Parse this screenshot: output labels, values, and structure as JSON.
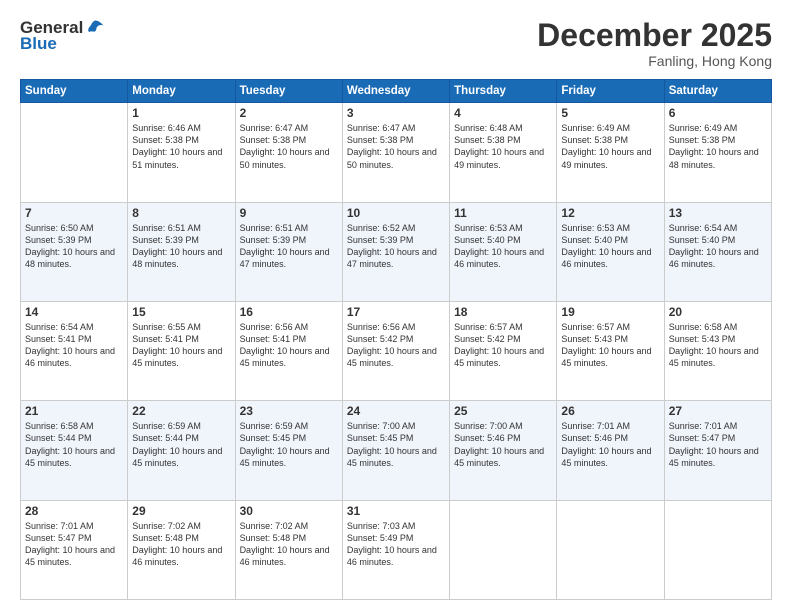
{
  "logo": {
    "general": "General",
    "blue": "Blue"
  },
  "title": "December 2025",
  "subtitle": "Fanling, Hong Kong",
  "header_days": [
    "Sunday",
    "Monday",
    "Tuesday",
    "Wednesday",
    "Thursday",
    "Friday",
    "Saturday"
  ],
  "weeks": [
    [
      {
        "day": "",
        "sunrise": "",
        "sunset": "",
        "daylight": ""
      },
      {
        "day": "1",
        "sunrise": "Sunrise: 6:46 AM",
        "sunset": "Sunset: 5:38 PM",
        "daylight": "Daylight: 10 hours and 51 minutes."
      },
      {
        "day": "2",
        "sunrise": "Sunrise: 6:47 AM",
        "sunset": "Sunset: 5:38 PM",
        "daylight": "Daylight: 10 hours and 50 minutes."
      },
      {
        "day": "3",
        "sunrise": "Sunrise: 6:47 AM",
        "sunset": "Sunset: 5:38 PM",
        "daylight": "Daylight: 10 hours and 50 minutes."
      },
      {
        "day": "4",
        "sunrise": "Sunrise: 6:48 AM",
        "sunset": "Sunset: 5:38 PM",
        "daylight": "Daylight: 10 hours and 49 minutes."
      },
      {
        "day": "5",
        "sunrise": "Sunrise: 6:49 AM",
        "sunset": "Sunset: 5:38 PM",
        "daylight": "Daylight: 10 hours and 49 minutes."
      },
      {
        "day": "6",
        "sunrise": "Sunrise: 6:49 AM",
        "sunset": "Sunset: 5:38 PM",
        "daylight": "Daylight: 10 hours and 48 minutes."
      }
    ],
    [
      {
        "day": "7",
        "sunrise": "Sunrise: 6:50 AM",
        "sunset": "Sunset: 5:39 PM",
        "daylight": "Daylight: 10 hours and 48 minutes."
      },
      {
        "day": "8",
        "sunrise": "Sunrise: 6:51 AM",
        "sunset": "Sunset: 5:39 PM",
        "daylight": "Daylight: 10 hours and 48 minutes."
      },
      {
        "day": "9",
        "sunrise": "Sunrise: 6:51 AM",
        "sunset": "Sunset: 5:39 PM",
        "daylight": "Daylight: 10 hours and 47 minutes."
      },
      {
        "day": "10",
        "sunrise": "Sunrise: 6:52 AM",
        "sunset": "Sunset: 5:39 PM",
        "daylight": "Daylight: 10 hours and 47 minutes."
      },
      {
        "day": "11",
        "sunrise": "Sunrise: 6:53 AM",
        "sunset": "Sunset: 5:40 PM",
        "daylight": "Daylight: 10 hours and 46 minutes."
      },
      {
        "day": "12",
        "sunrise": "Sunrise: 6:53 AM",
        "sunset": "Sunset: 5:40 PM",
        "daylight": "Daylight: 10 hours and 46 minutes."
      },
      {
        "day": "13",
        "sunrise": "Sunrise: 6:54 AM",
        "sunset": "Sunset: 5:40 PM",
        "daylight": "Daylight: 10 hours and 46 minutes."
      }
    ],
    [
      {
        "day": "14",
        "sunrise": "Sunrise: 6:54 AM",
        "sunset": "Sunset: 5:41 PM",
        "daylight": "Daylight: 10 hours and 46 minutes."
      },
      {
        "day": "15",
        "sunrise": "Sunrise: 6:55 AM",
        "sunset": "Sunset: 5:41 PM",
        "daylight": "Daylight: 10 hours and 45 minutes."
      },
      {
        "day": "16",
        "sunrise": "Sunrise: 6:56 AM",
        "sunset": "Sunset: 5:41 PM",
        "daylight": "Daylight: 10 hours and 45 minutes."
      },
      {
        "day": "17",
        "sunrise": "Sunrise: 6:56 AM",
        "sunset": "Sunset: 5:42 PM",
        "daylight": "Daylight: 10 hours and 45 minutes."
      },
      {
        "day": "18",
        "sunrise": "Sunrise: 6:57 AM",
        "sunset": "Sunset: 5:42 PM",
        "daylight": "Daylight: 10 hours and 45 minutes."
      },
      {
        "day": "19",
        "sunrise": "Sunrise: 6:57 AM",
        "sunset": "Sunset: 5:43 PM",
        "daylight": "Daylight: 10 hours and 45 minutes."
      },
      {
        "day": "20",
        "sunrise": "Sunrise: 6:58 AM",
        "sunset": "Sunset: 5:43 PM",
        "daylight": "Daylight: 10 hours and 45 minutes."
      }
    ],
    [
      {
        "day": "21",
        "sunrise": "Sunrise: 6:58 AM",
        "sunset": "Sunset: 5:44 PM",
        "daylight": "Daylight: 10 hours and 45 minutes."
      },
      {
        "day": "22",
        "sunrise": "Sunrise: 6:59 AM",
        "sunset": "Sunset: 5:44 PM",
        "daylight": "Daylight: 10 hours and 45 minutes."
      },
      {
        "day": "23",
        "sunrise": "Sunrise: 6:59 AM",
        "sunset": "Sunset: 5:45 PM",
        "daylight": "Daylight: 10 hours and 45 minutes."
      },
      {
        "day": "24",
        "sunrise": "Sunrise: 7:00 AM",
        "sunset": "Sunset: 5:45 PM",
        "daylight": "Daylight: 10 hours and 45 minutes."
      },
      {
        "day": "25",
        "sunrise": "Sunrise: 7:00 AM",
        "sunset": "Sunset: 5:46 PM",
        "daylight": "Daylight: 10 hours and 45 minutes."
      },
      {
        "day": "26",
        "sunrise": "Sunrise: 7:01 AM",
        "sunset": "Sunset: 5:46 PM",
        "daylight": "Daylight: 10 hours and 45 minutes."
      },
      {
        "day": "27",
        "sunrise": "Sunrise: 7:01 AM",
        "sunset": "Sunset: 5:47 PM",
        "daylight": "Daylight: 10 hours and 45 minutes."
      }
    ],
    [
      {
        "day": "28",
        "sunrise": "Sunrise: 7:01 AM",
        "sunset": "Sunset: 5:47 PM",
        "daylight": "Daylight: 10 hours and 45 minutes."
      },
      {
        "day": "29",
        "sunrise": "Sunrise: 7:02 AM",
        "sunset": "Sunset: 5:48 PM",
        "daylight": "Daylight: 10 hours and 46 minutes."
      },
      {
        "day": "30",
        "sunrise": "Sunrise: 7:02 AM",
        "sunset": "Sunset: 5:48 PM",
        "daylight": "Daylight: 10 hours and 46 minutes."
      },
      {
        "day": "31",
        "sunrise": "Sunrise: 7:03 AM",
        "sunset": "Sunset: 5:49 PM",
        "daylight": "Daylight: 10 hours and 46 minutes."
      },
      {
        "day": "",
        "sunrise": "",
        "sunset": "",
        "daylight": ""
      },
      {
        "day": "",
        "sunrise": "",
        "sunset": "",
        "daylight": ""
      },
      {
        "day": "",
        "sunrise": "",
        "sunset": "",
        "daylight": ""
      }
    ]
  ]
}
